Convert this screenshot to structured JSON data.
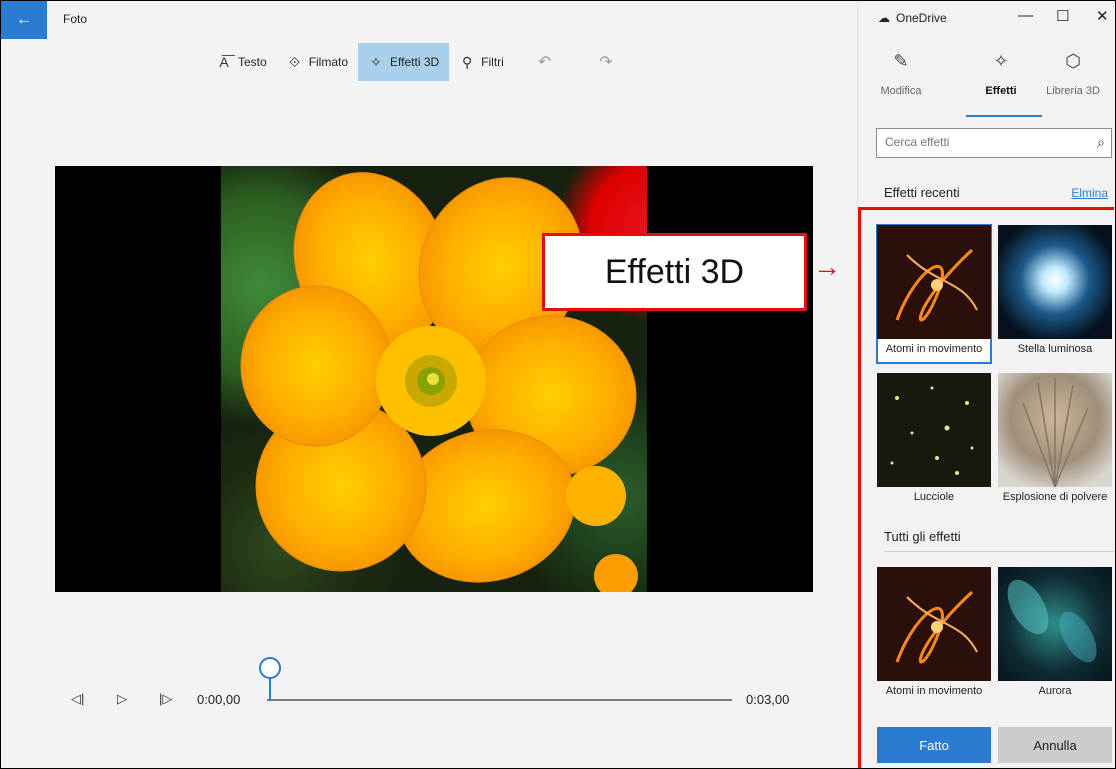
{
  "app": {
    "title": "Foto",
    "back_icon": "←"
  },
  "toolbar": {
    "items": [
      {
        "label": "Testo",
        "icon": "text-icon",
        "glyph": "A͞"
      },
      {
        "label": "Filmato",
        "icon": "motion-icon",
        "glyph": "⟐"
      },
      {
        "label": "Effetti 3D",
        "icon": "effects3d-icon",
        "glyph": "✧"
      },
      {
        "label": "Filtri",
        "icon": "filter-icon",
        "glyph": "⚲"
      }
    ],
    "undo_glyph": "↶",
    "redo_glyph": "↷"
  },
  "timeline": {
    "current": "0:00,00",
    "total": "0:03,00",
    "progress": 0.0,
    "prev_glyph": "◁|",
    "play_glyph": "▷",
    "next_glyph": "|▷"
  },
  "callout": {
    "label": "Effetti 3D",
    "arrow": "→"
  },
  "panel": {
    "onedrive": "OneDrive",
    "onedrive_glyph": "☁",
    "win_min": "—",
    "win_max": "☐",
    "win_close": "✕",
    "tabs": [
      {
        "label": "Modifica",
        "glyph": "✎"
      },
      {
        "label": "Effetti",
        "glyph": "✧"
      },
      {
        "label": "Libreria 3D",
        "glyph": "⬡"
      }
    ],
    "search_placeholder": "Cerca effetti",
    "search_glyph": "⌕",
    "recent_title": "Effetti recenti",
    "clear_label": "Elmina",
    "recent": [
      {
        "caption": "Atomi in movimento"
      },
      {
        "caption": "Stella luminosa"
      },
      {
        "caption": "Lucciole"
      },
      {
        "caption": "Esplosione di polvere"
      }
    ],
    "all_title": "Tutti gli effetti",
    "all": [
      {
        "caption": "Atomi in movimento"
      },
      {
        "caption": "Aurora"
      }
    ],
    "done_label": "Fatto",
    "cancel_label": "Annulla"
  },
  "colors": {
    "accent": "#2b7bd1",
    "highlight": "#a9d0ea",
    "callout_red": "#e01010"
  }
}
